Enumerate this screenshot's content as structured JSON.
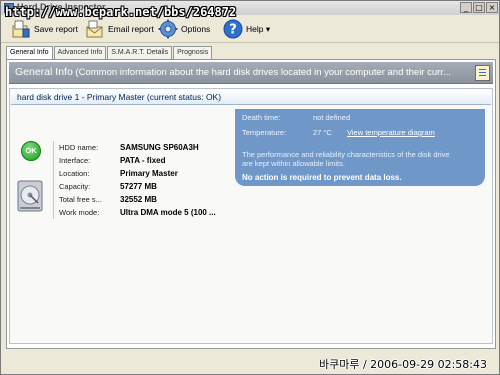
{
  "window": {
    "title": "Hard Drive Inspector",
    "url_overlay": "http://www.bcpark.net/bbs/264872",
    "min": "_",
    "max": "□",
    "close": "×"
  },
  "toolbar": {
    "save_label": "Save report",
    "email_label": "Email report",
    "options_label": "Options",
    "help_label": "Help ▾"
  },
  "tabs": [
    {
      "label": "General Info",
      "active": true
    },
    {
      "label": "Advanced Info",
      "active": false
    },
    {
      "label": "S.M.A.R.T. Details",
      "active": false
    },
    {
      "label": "Prognosis",
      "active": false
    }
  ],
  "general": {
    "title": "General Info",
    "desc": " (Common information about the hard disk drives located in your computer and their curr..."
  },
  "drive": {
    "header": "hard disk drive 1 - Primary Master (current status: OK)",
    "status_badge": "OK",
    "fields": [
      {
        "label": "HDD name:",
        "value": "SAMSUNG SP60A3H"
      },
      {
        "label": "Interface:",
        "value": "PATA - fixed"
      },
      {
        "label": "Location:",
        "value": "Primary Master"
      },
      {
        "label": "Capacity:",
        "value": "57277 MB"
      },
      {
        "label": "Total free s...",
        "value": "32552 MB"
      },
      {
        "label": "Work mode:",
        "value": "Ultra DMA mode 5 (100 ..."
      }
    ]
  },
  "status": {
    "death_label": "Death time:",
    "death_value": "not defined",
    "temp_label": "Temperature:",
    "temp_value": "27 °C",
    "temp_link": "View temperature diagram",
    "description": "The performance and reliability characteristics of the disk drive are kept within allowable limits.",
    "action": "No action is required to prevent data loss."
  },
  "watermark": "바쿠마루 / 2006-09-29 02:58:43",
  "colors": {
    "header_gray": "#8a939e",
    "status_blue": "#6f98c9",
    "ok_green": "#1f9a1f"
  },
  "icons": [
    "app-icon",
    "save-report-icon",
    "email-report-icon",
    "options-gear-icon",
    "help-icon",
    "report-view-icon",
    "ok-status-icon",
    "hard-drive-icon"
  ]
}
